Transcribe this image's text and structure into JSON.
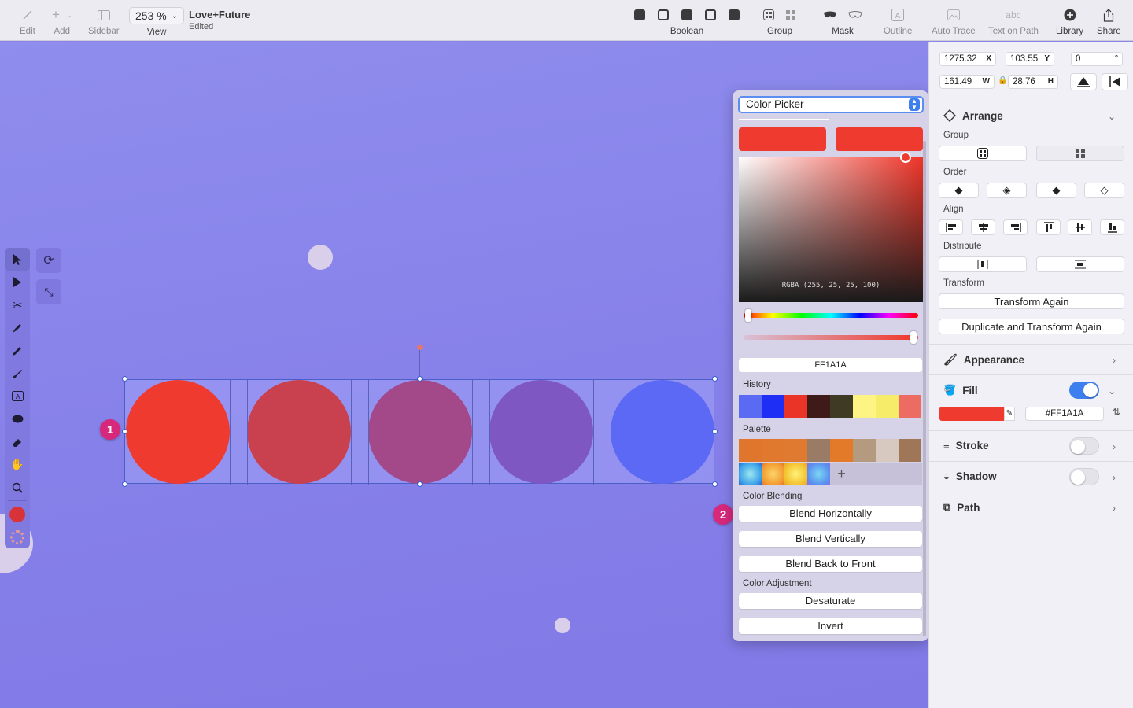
{
  "toolbar": {
    "edit_label": "Edit",
    "add_label": "Add",
    "sidebar_label": "Sidebar",
    "zoom_value": "253 %",
    "view_label": "View",
    "doc_title": "Love+Future",
    "doc_status": "Edited",
    "boolean_label": "Boolean",
    "group_label": "Group",
    "mask_label": "Mask",
    "outline_label": "Outline",
    "auto_trace_label": "Auto Trace",
    "text_on_path_label": "Text on Path",
    "text_on_path_icon_text": "abc",
    "library_label": "Library",
    "share_label": "Share"
  },
  "canvas": {
    "circle_colors": [
      "#ef3b2f",
      "#c9414f",
      "#a34889",
      "#7e57c2",
      "#5b69f4"
    ],
    "badge_1": "1",
    "badge_2": "2"
  },
  "color_picker": {
    "mode": "Color Picker",
    "current_color": "#ef3b2f",
    "rgba_text": "RGBA (255, 25, 25, 100)",
    "hex_value": "FF1A1A",
    "history_label": "History",
    "history_colors": [
      "#5b6af2",
      "#1f2ef5",
      "#ea3428",
      "#3e1a19",
      "#3f3a24",
      "#fdf483",
      "#f6ec6a",
      "#ec6b62"
    ],
    "palette_label": "Palette",
    "palette_row1": [
      "#e0762b",
      "#e0782e",
      "#df7a30",
      "#9a7b66",
      "#e27a2a",
      "#b49a7e",
      "#d7c9bf",
      "#9f7658"
    ],
    "palette_row2": [
      "gradient-cyan",
      "gradient-orange",
      "gradient-yellow",
      "gradient-blue"
    ],
    "add_symbol": "+",
    "color_blending_label": "Color Blending",
    "blend_horizontally": "Blend Horizontally",
    "blend_vertically": "Blend Vertically",
    "blend_back_to_front": "Blend Back to Front",
    "color_adjustment_label": "Color Adjustment",
    "desaturate": "Desaturate",
    "invert": "Invert"
  },
  "inspector": {
    "x_value": "1275.32",
    "x_suffix": "X",
    "y_value": "103.55",
    "y_suffix": "Y",
    "rotation_value": "0",
    "rotation_suffix": "°",
    "w_value": "161.49",
    "w_suffix": "W",
    "h_value": "28.76",
    "h_suffix": "H",
    "arrange_title": "Arrange",
    "group_label": "Group",
    "order_label": "Order",
    "align_label": "Align",
    "distribute_label": "Distribute",
    "transform_label": "Transform",
    "transform_again": "Transform Again",
    "duplicate_transform_again": "Duplicate and Transform Again",
    "appearance_title": "Appearance",
    "fill_title": "Fill",
    "fill_color": "#ef3b2f",
    "fill_hex": "#FF1A1A",
    "stroke_title": "Stroke",
    "shadow_title": "Shadow",
    "path_title": "Path",
    "accent": "#3e7ff0"
  }
}
